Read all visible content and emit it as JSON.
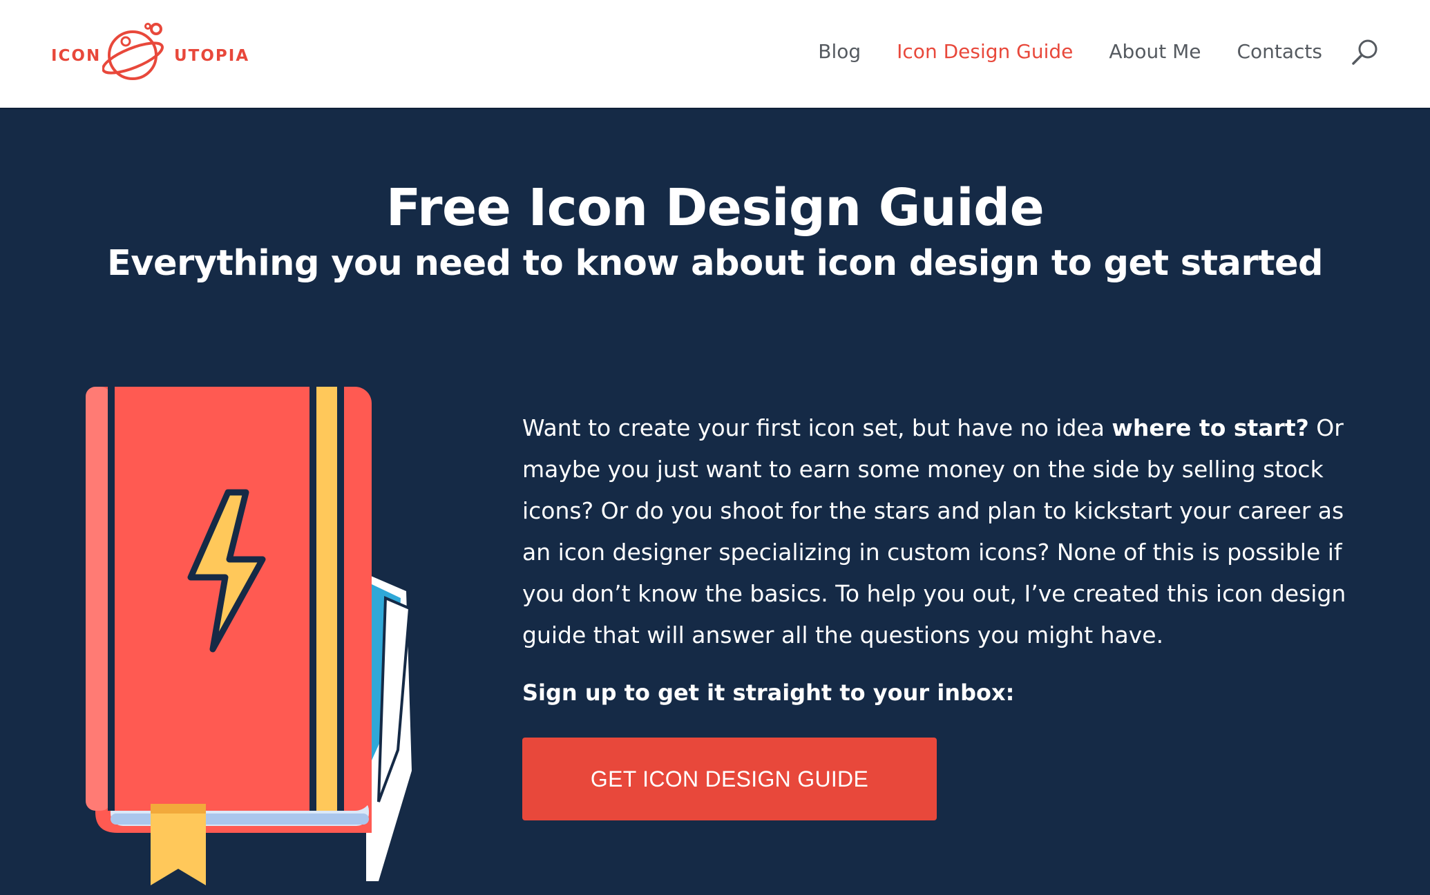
{
  "header": {
    "logo": {
      "text_left": "ICON",
      "text_right": "UTOPIA"
    },
    "nav": [
      {
        "label": "Blog",
        "active": false
      },
      {
        "label": "Icon Design Guide",
        "active": true
      },
      {
        "label": "About Me",
        "active": false
      },
      {
        "label": "Contacts",
        "active": false
      }
    ],
    "search_icon": "search-icon"
  },
  "hero": {
    "title": "Free Icon Design Guide",
    "subtitle": "Everything you need to know about icon design to get started",
    "illustration": "book-with-lightning-icon",
    "description": {
      "part1": "Want to create your first icon set, but have no idea ",
      "bold": "where to start?",
      "part2": " Or maybe you just want to earn some money on the side by selling stock icons? Or do you shoot for the stars and plan to kickstart your career as an icon designer specializing in custom icons? None of this is possible if you don’t know the basics. To help you out, I’ve created this icon design guide that will answer all the questions you might have."
    },
    "signup_text": "Sign up to get it straight to your inbox:",
    "cta_label": "GET ICON DESIGN GUIDE"
  },
  "colors": {
    "accent": "#e8483b",
    "background": "#152a46",
    "nav_text": "#555a60",
    "header_bg": "#ffffff"
  }
}
